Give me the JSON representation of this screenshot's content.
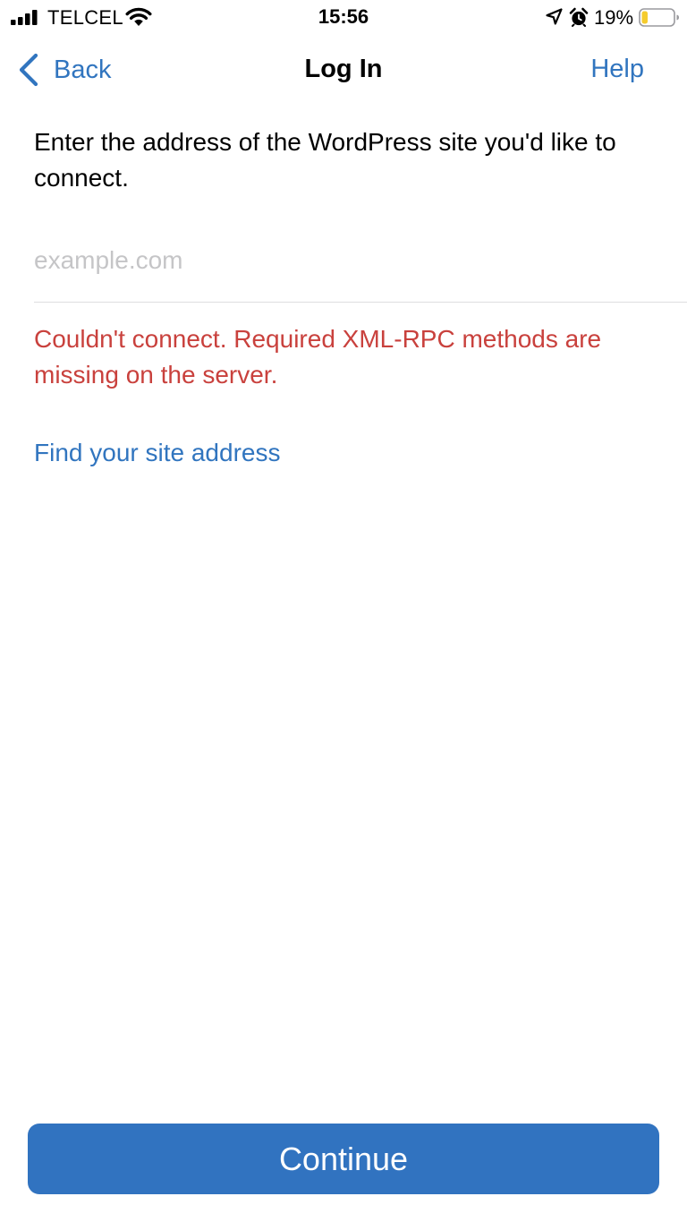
{
  "status_bar": {
    "carrier": "TELCEL",
    "time": "15:56",
    "battery_percent": "19%",
    "battery_level": 0.19,
    "icons": [
      "signal-icon",
      "wifi-icon",
      "location-icon",
      "alarm-icon",
      "battery-icon"
    ]
  },
  "nav": {
    "back_label": "Back",
    "title": "Log In",
    "help_label": "Help"
  },
  "content": {
    "instructions": "Enter the address of the WordPress site you'd like to connect.",
    "site_input": {
      "placeholder": "example.com",
      "value": ""
    },
    "error": "Couldn't connect. Required XML-RPC methods are missing on the server.",
    "find_site_link": "Find your site address"
  },
  "footer": {
    "continue_label": "Continue"
  },
  "colors": {
    "accent": "#3175bf",
    "button": "#3173c0",
    "error": "#c9413d",
    "placeholder": "#c5c5c7",
    "battery_low": "#f5cc2e"
  }
}
